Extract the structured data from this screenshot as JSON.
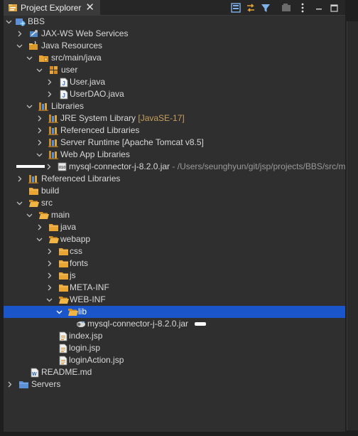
{
  "tab": {
    "title": "Project Explorer",
    "icon": "project-explorer-icon",
    "close": "✕"
  },
  "toolbar": [
    "collapse-all-icon",
    "link-with-editor-icon",
    "filter-icon",
    "focus-icon",
    "view-menu-icon",
    "minimize-icon",
    "maximize-icon"
  ],
  "tree": [
    {
      "id": "bbs",
      "label": "BBS",
      "icon": "web-project-icon",
      "expanded": true
    },
    {
      "id": "jaxws",
      "label": "JAX-WS Web Services",
      "icon": "jaxws-icon",
      "expanded": false
    },
    {
      "id": "java-resources",
      "label": "Java Resources",
      "icon": "java-resources-icon",
      "expanded": true
    },
    {
      "id": "src-main-java",
      "label": "src/main/java",
      "icon": "package-folder-icon",
      "expanded": true
    },
    {
      "id": "pkg-user",
      "label": "user",
      "icon": "package-icon",
      "expanded": true
    },
    {
      "id": "user-java",
      "label": "User.java",
      "icon": "java-file-icon",
      "expanded": false
    },
    {
      "id": "userdao-java",
      "label": "UserDAO.java",
      "icon": "java-file-icon",
      "expanded": false
    },
    {
      "id": "libraries",
      "label": "Libraries",
      "icon": "library-icon",
      "expanded": true
    },
    {
      "id": "jre",
      "label": "JRE System Library",
      "suffix": "[JavaSE-17]",
      "icon": "library-icon",
      "expanded": false
    },
    {
      "id": "ref-libs-1",
      "label": "Referenced Libraries",
      "icon": "library-icon",
      "expanded": false
    },
    {
      "id": "server-runtime",
      "label": "Server Runtime [Apache Tomcat v8.5]",
      "icon": "library-icon",
      "expanded": false
    },
    {
      "id": "webapp-libs",
      "label": "Web App Libraries",
      "icon": "library-icon",
      "expanded": true
    },
    {
      "id": "mysql-jar-1",
      "label": "mysql-connector-j-8.2.0.jar",
      "suffix": "- /Users/seunghyun/git/jsp/projects/BBS/src/m",
      "icon": "jar-icon",
      "expanded": false
    },
    {
      "id": "ref-libs-2",
      "label": "Referenced Libraries",
      "icon": "library-icon",
      "expanded": false
    },
    {
      "id": "build",
      "label": "build",
      "icon": "folder-icon",
      "expanded": null
    },
    {
      "id": "src",
      "label": "src",
      "icon": "folder-open-icon",
      "expanded": true
    },
    {
      "id": "main",
      "label": "main",
      "icon": "folder-open-icon",
      "expanded": true
    },
    {
      "id": "java",
      "label": "java",
      "icon": "folder-icon",
      "expanded": false
    },
    {
      "id": "webapp",
      "label": "webapp",
      "icon": "folder-open-icon",
      "expanded": true
    },
    {
      "id": "css",
      "label": "css",
      "icon": "folder-icon",
      "expanded": false
    },
    {
      "id": "fonts",
      "label": "fonts",
      "icon": "folder-icon",
      "expanded": false
    },
    {
      "id": "js",
      "label": "js",
      "icon": "folder-icon",
      "expanded": false
    },
    {
      "id": "meta-inf",
      "label": "META-INF",
      "icon": "folder-icon",
      "expanded": false
    },
    {
      "id": "web-inf",
      "label": "WEB-INF",
      "icon": "folder-open-icon",
      "expanded": true
    },
    {
      "id": "lib",
      "label": "lib",
      "icon": "folder-open-icon",
      "expanded": true,
      "selected": true
    },
    {
      "id": "mysql-jar-2",
      "label": "mysql-connector-j-8.2.0.jar",
      "icon": "jar-file-icon",
      "expanded": null
    },
    {
      "id": "index-jsp",
      "label": "index.jsp",
      "icon": "jsp-file-icon",
      "expanded": null
    },
    {
      "id": "login-jsp",
      "label": "login.jsp",
      "icon": "jsp-file-icon",
      "expanded": null
    },
    {
      "id": "loginaction-jsp",
      "label": "loginAction.jsp",
      "icon": "jsp-file-icon",
      "expanded": null
    },
    {
      "id": "readme",
      "label": "README.md",
      "icon": "markdown-file-icon",
      "expanded": null
    },
    {
      "id": "servers",
      "label": "Servers",
      "icon": "server-folder-icon",
      "expanded": false
    }
  ],
  "colors": {
    "background": "#2f2f2f",
    "selection": "#1a56c9",
    "folder": "#e8a534",
    "library": "#c98a2a",
    "muted": "#9a9a9a"
  }
}
